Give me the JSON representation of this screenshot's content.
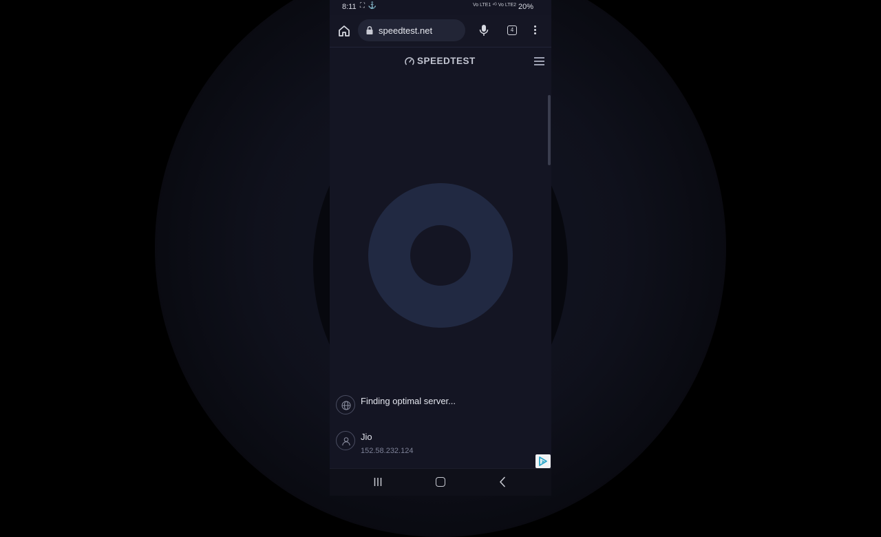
{
  "status_bar": {
    "time": "8:11",
    "left_icons": "⛶ ⚓",
    "right_icons": "Vo LTE1 ⁴ᴳ Vo LTE2",
    "battery": "20%"
  },
  "browser": {
    "url": "speedtest.net",
    "tab_count": "4",
    "icons": [
      "home-icon",
      "lock-icon",
      "mic-icon",
      "tabs-icon",
      "more-vert-icon"
    ]
  },
  "header": {
    "brand": "SPEEDTEST",
    "icons": [
      "speedtest-logo-icon",
      "hamburger-icon"
    ]
  },
  "server": {
    "status": "Finding optimal server..."
  },
  "provider": {
    "name": "Jio",
    "ip": "152.58.232.124"
  },
  "colors": {
    "page_bg": "#141523",
    "donut": "#212942",
    "text_primary": "#e4e6ee",
    "text_secondary": "#7d8196"
  }
}
